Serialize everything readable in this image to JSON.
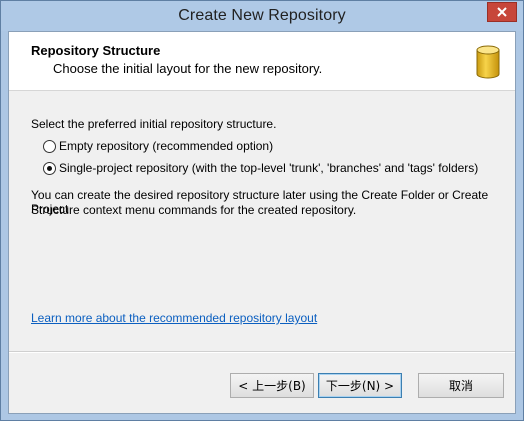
{
  "window": {
    "title": "Create New Repository"
  },
  "header": {
    "title": "Repository Structure",
    "subtitle": "Choose the initial layout for the new repository."
  },
  "body": {
    "prompt": "Select the preferred initial repository structure.",
    "options": [
      {
        "label": "Empty repository (recommended option)",
        "selected": false
      },
      {
        "label": "Single-project repository (with the top-level 'trunk', 'branches' and 'tags' folders)",
        "selected": true
      }
    ],
    "note_line1": "You can create the desired repository structure later using the Create Folder or Create Project",
    "note_line2": "Structure context menu commands for the created repository.",
    "link": "Learn more about the recommended repository layout"
  },
  "buttons": {
    "back": "< 上一步(B)",
    "next": "下一步(N) >",
    "cancel": "取消"
  },
  "icons": {
    "close": "close-icon",
    "database": "database-icon"
  },
  "colors": {
    "titlebar": "#afc9e6",
    "close_button": "#c7463a",
    "link": "#0b5fc0",
    "icon_gold": "#f2c230"
  }
}
